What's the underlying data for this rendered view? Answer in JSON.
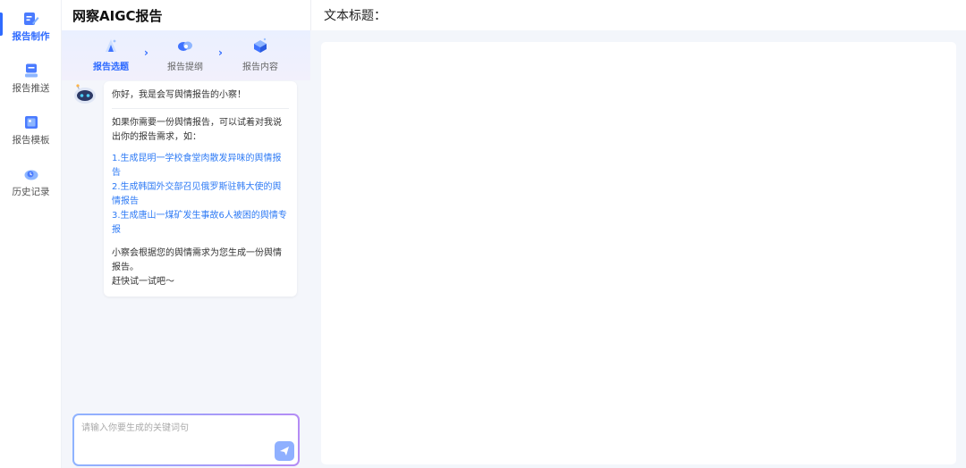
{
  "sidebar": {
    "items": [
      {
        "label": "报告制作",
        "icon": "report-make-icon",
        "active": true
      },
      {
        "label": "报告推送",
        "icon": "report-push-icon"
      },
      {
        "label": "报告模板",
        "icon": "report-template-icon"
      },
      {
        "label": "历史记录",
        "icon": "history-icon"
      }
    ]
  },
  "panel": {
    "title": "网察AIGC报告",
    "steps": [
      {
        "label": "报告选题",
        "active": true
      },
      {
        "label": "报告提纲"
      },
      {
        "label": "报告内容"
      }
    ]
  },
  "chat": {
    "greeting": "你好，我是会写舆情报告的小察！",
    "intro": "如果你需要一份舆情报告，可以试着对我说出你的报告需求，如：",
    "examples": [
      "1.生成昆明一学校食堂肉散发异味的舆情报告",
      "2.生成韩国外交部召见俄罗斯驻韩大使的舆情报告",
      "3.生成唐山一煤矿发生事故6人被困的舆情专报"
    ],
    "outro1": "小察会根据您的舆情需求为您生成一份舆情报告。",
    "outro2": "赶快试一试吧～"
  },
  "input": {
    "placeholder": "请输入你要生成的关键词句",
    "value": ""
  },
  "main": {
    "title": "文本标题："
  },
  "colors": {
    "accent": "#2f6bff",
    "link": "#2f7bf5",
    "background": "#f3f6fb"
  }
}
